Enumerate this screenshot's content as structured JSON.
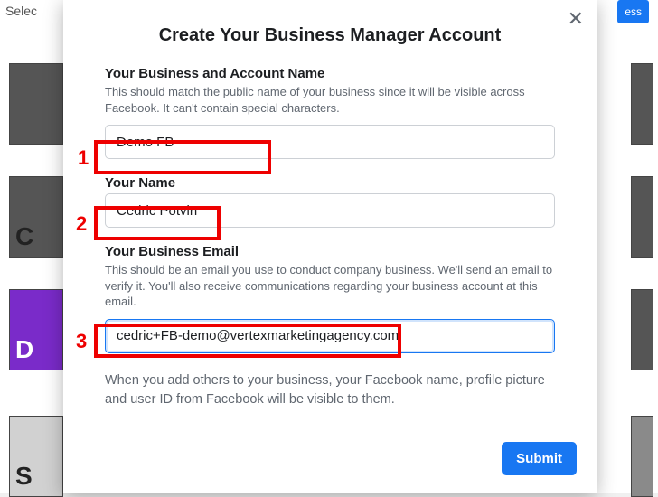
{
  "background": {
    "topLeftText": "Selec",
    "topRightButton": "ess"
  },
  "modal": {
    "title": "Create Your Business Manager Account",
    "fields": {
      "business": {
        "label": "Your Business and Account Name",
        "help": "This should match the public name of your business since it will be visible across Facebook. It can't contain special characters.",
        "value": "Demo FB"
      },
      "name": {
        "label": "Your Name",
        "value": "Cedric Potvin"
      },
      "email": {
        "label": "Your Business Email",
        "help": "This should be an email you use to conduct company business. We'll send an email to verify it. You'll also receive communications regarding your business account at this email.",
        "value": "cedric+FB-demo@vertexmarketingagency.com"
      }
    },
    "notice": "When you add others to your business, your Facebook name, profile picture and user ID from Facebook will be visible to them.",
    "submit": "Submit"
  },
  "annotations": {
    "num1": "1",
    "num2": "2",
    "num3": "3"
  }
}
